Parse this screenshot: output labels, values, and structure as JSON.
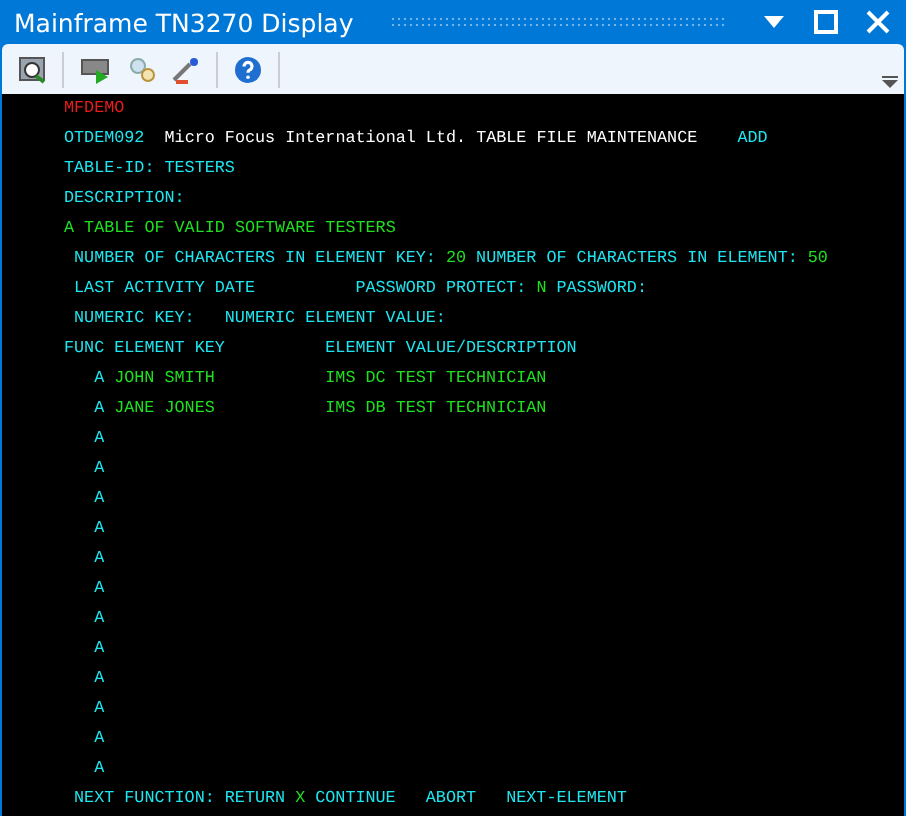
{
  "window": {
    "title": "Mainframe TN3270 Display"
  },
  "screen": {
    "system": "MFDEMO",
    "header": {
      "program": "OTDEM092",
      "title": "Micro Focus International Ltd. TABLE FILE MAINTENANCE",
      "mode": "ADD"
    },
    "table_id": {
      "label": "TABLE-ID:",
      "value": "TESTERS"
    },
    "description": {
      "label": "DESCRIPTION:",
      "value": "A TABLE OF VALID SOFTWARE TESTERS"
    },
    "key_chars": {
      "label": "NUMBER OF CHARACTERS IN ELEMENT KEY:",
      "value": "20"
    },
    "element_chars": {
      "label": "NUMBER OF CHARACTERS IN ELEMENT:",
      "value": "50"
    },
    "last_activity": {
      "label": "LAST ACTIVITY DATE"
    },
    "password_protect": {
      "label": "PASSWORD PROTECT:",
      "value": "N"
    },
    "password": {
      "label": "PASSWORD:"
    },
    "numeric_key": {
      "label": "NUMERIC KEY:"
    },
    "numeric_value": {
      "label": "NUMERIC ELEMENT VALUE:"
    },
    "columns": [
      "FUNC ELEMENT KEY",
      "ELEMENT VALUE/DESCRIPTION"
    ],
    "rows": [
      {
        "func": "A",
        "key": "JOHN SMITH",
        "value": "IMS DC TEST TECHNICIAN"
      },
      {
        "func": "A",
        "key": "JANE JONES",
        "value": "IMS DB TEST TECHNICIAN"
      },
      {
        "func": "A"
      },
      {
        "func": "A"
      },
      {
        "func": "A"
      },
      {
        "func": "A"
      },
      {
        "func": "A"
      },
      {
        "func": "A"
      },
      {
        "func": "A"
      },
      {
        "func": "A"
      },
      {
        "func": "A"
      },
      {
        "func": "A"
      },
      {
        "func": "A"
      },
      {
        "func": "A"
      }
    ],
    "footer": {
      "label": "NEXT FUNCTION:",
      "first_option": "RETURN",
      "value": "X",
      "options": [
        "CONTINUE",
        "ABORT",
        "NEXT-ELEMENT"
      ]
    }
  }
}
